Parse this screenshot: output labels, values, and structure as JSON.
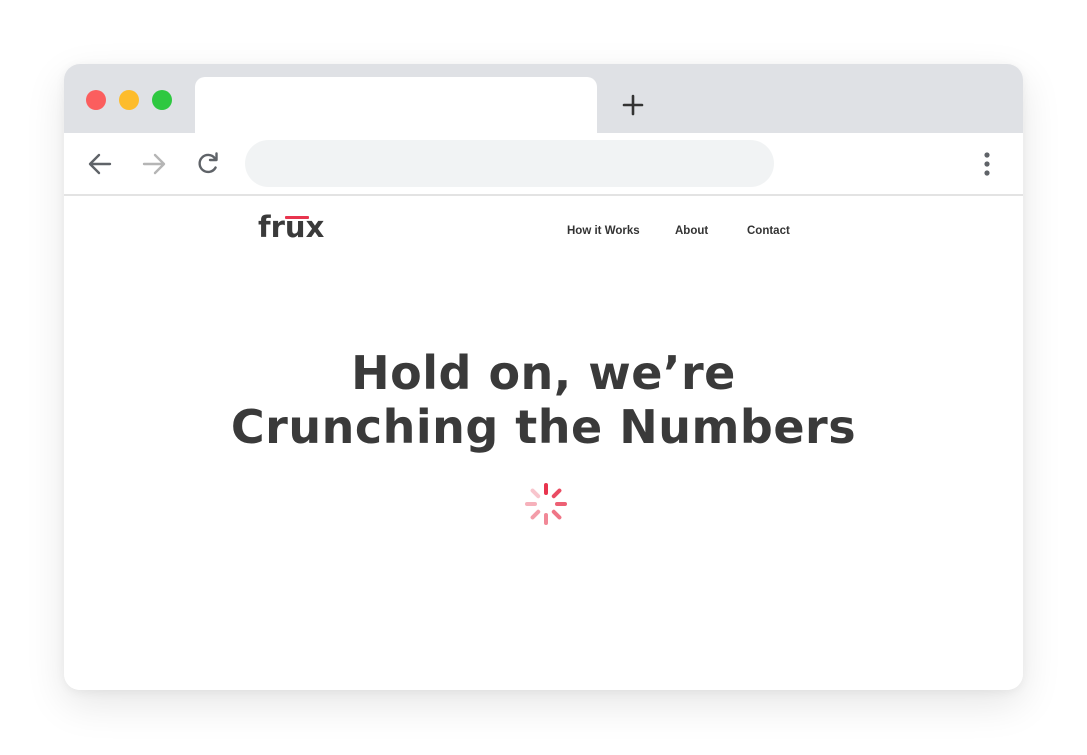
{
  "browser": {
    "tab_title": "",
    "address": "",
    "icons": {
      "new_tab": "plus-icon",
      "back": "arrow-left-icon",
      "forward": "arrow-right-icon",
      "reload": "reload-icon",
      "menu": "kebab-menu-icon"
    },
    "colors": {
      "close": "#fb5e5e",
      "minimize": "#fdbc2c",
      "maximize": "#2ec840",
      "chrome": "#dfe1e5"
    }
  },
  "site": {
    "logo": "frux",
    "nav": [
      "How it Works",
      "About",
      "Contact"
    ],
    "headline_line1": "Hold on, we’re",
    "headline_line2": "Crunching the Numbers",
    "spinner_icon": "loading-spinner-icon",
    "accent": "#e8344e",
    "text_color": "#3a3a3a"
  }
}
